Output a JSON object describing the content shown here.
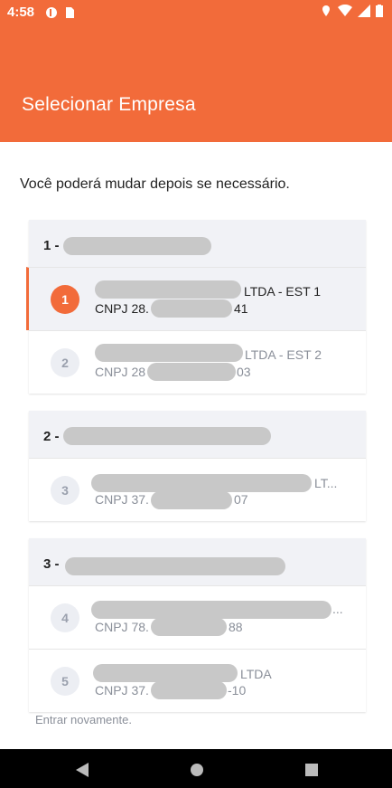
{
  "status_bar": {
    "time": "4:58"
  },
  "header": {
    "title": "Selecionar Empresa"
  },
  "subtitle": "Você poderá mudar depois se necessário.",
  "groups": [
    {
      "number": "1 -",
      "items": [
        {
          "badge": "1",
          "name_suffix": "LTDA - EST 1",
          "cnpj_prefix": "CNPJ 28.",
          "cnpj_suffix": "41",
          "selected": true
        },
        {
          "badge": "2",
          "name_suffix": "LTDA - EST 2",
          "cnpj_prefix": "CNPJ 28",
          "cnpj_suffix": "03",
          "selected": false
        }
      ]
    },
    {
      "number": "2 -",
      "items": [
        {
          "badge": "3",
          "name_suffix": "LT...",
          "cnpj_prefix": "CNPJ 37.",
          "cnpj_suffix": "07",
          "selected": false
        }
      ]
    },
    {
      "number": "3 -",
      "items": [
        {
          "badge": "4",
          "name_suffix": "...",
          "cnpj_prefix": "CNPJ 78.",
          "cnpj_suffix": "88",
          "selected": false
        },
        {
          "badge": "5",
          "name_suffix": "LTDA",
          "cnpj_prefix": "CNPJ 37.",
          "cnpj_suffix": "-10",
          "selected": false
        }
      ]
    }
  ],
  "footer_link": "Entrar novamente.",
  "colors": {
    "accent": "#f26b3a",
    "card_header": "#f1f2f6"
  }
}
